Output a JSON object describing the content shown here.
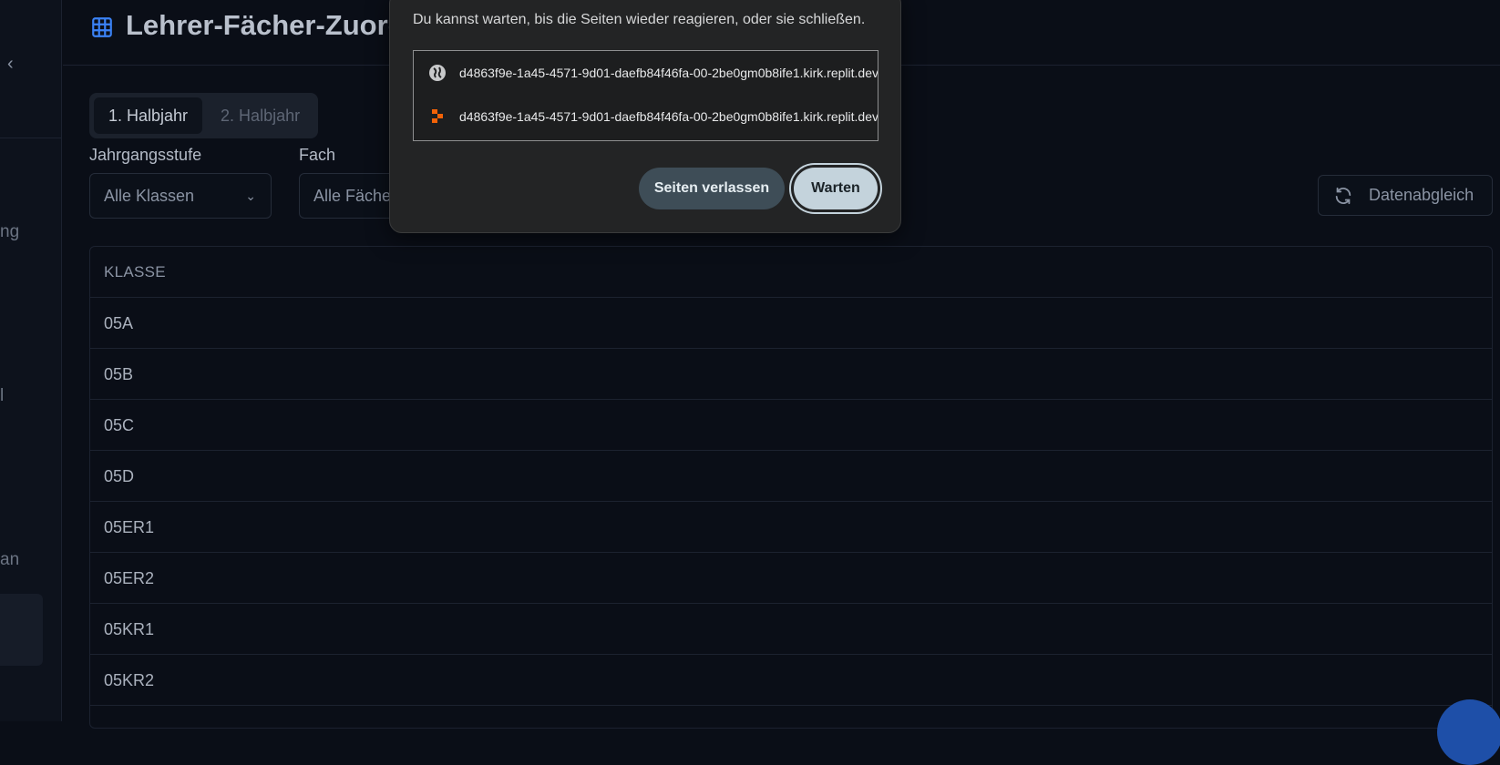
{
  "sidebar": {
    "collapse_icon": "chevron-left-icon",
    "fragments": [
      "ng",
      "l",
      "an"
    ]
  },
  "header": {
    "icon": "table-grid-icon",
    "title": "Lehrer-Fächer-Zuord"
  },
  "tabs": [
    {
      "label": "1. Halbjahr",
      "active": true
    },
    {
      "label": "2. Halbjahr",
      "active": false
    }
  ],
  "filters": {
    "grade_label": "Jahrgangsstufe",
    "grade_value": "Alle Klassen",
    "subject_label": "Fach",
    "subject_value": "Alle Fächer"
  },
  "sync_button": {
    "label": "Datenabgleich",
    "icon": "refresh-icon"
  },
  "table": {
    "header": "KLASSE",
    "rows": [
      "05A",
      "05B",
      "05C",
      "05D",
      "05ER1",
      "05ER2",
      "05KR1",
      "05KR2"
    ]
  },
  "dialog": {
    "message": "Du kannst warten, bis die Seiten wieder reagieren, oder sie schließen.",
    "items": [
      {
        "icon": "globe-icon",
        "text": "d4863f9e-1a45-4571-9d01-daefb84f46fa-00-2be0gm0b8ife1.kirk.replit.dev"
      },
      {
        "icon": "replit-icon",
        "text": "d4863f9e-1a45-4571-9d01-daefb84f46fa-00-2be0gm0b8ife1.kirk.replit.dev"
      }
    ],
    "leave_label": "Seiten verlassen",
    "wait_label": "Warten"
  },
  "colors": {
    "background": "#0a0e17",
    "accent": "#3b82f6",
    "dialog_bg": "#232425",
    "wait_button": "#c4d3dc",
    "leave_button": "#3e4d57"
  }
}
